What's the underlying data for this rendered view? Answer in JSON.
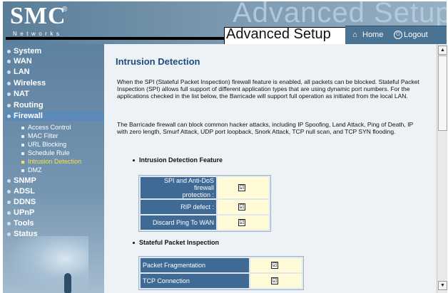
{
  "brand": {
    "logo": "SMC",
    "registered": "®",
    "sub": "Networks",
    "watermark": "Advanced Setup"
  },
  "header": {
    "title": "Advanced Setup",
    "home_icon": "⌂",
    "home_label": "Home",
    "logout_icon": "⏻",
    "logout_label": "Logout"
  },
  "sidebar": {
    "items": [
      {
        "label": "System"
      },
      {
        "label": "WAN"
      },
      {
        "label": "LAN"
      },
      {
        "label": "Wireless"
      },
      {
        "label": "NAT"
      },
      {
        "label": "Routing"
      },
      {
        "label": "Firewall"
      },
      {
        "label": "SNMP"
      },
      {
        "label": "ADSL"
      },
      {
        "label": "DDNS"
      },
      {
        "label": "UPnP"
      },
      {
        "label": "Tools"
      },
      {
        "label": "Status"
      }
    ],
    "firewall_sub": [
      {
        "label": "Access Control"
      },
      {
        "label": "MAC Filter"
      },
      {
        "label": "URL Blocking"
      },
      {
        "label": "Schedule Rule"
      },
      {
        "label": "Intrusion Detection"
      },
      {
        "label": "DMZ"
      }
    ]
  },
  "main": {
    "title": "Intrusion Detection",
    "para1": "When the SPI (Stateful Packet Inspection) firewall feature is enabled, all packets can be blocked. Stateful Packet Inspection (SPI) allows full support of different application types that are using dynamic port numbers. For the applications checked in the list below, the Barricade will support full operation as initiated from the local LAN.",
    "para2": "The Barricade firewall can block common hacker attacks, including IP Spoofing, Land Attack, Ping of Death, IP with zero length, Smurf Attack, UDP port loopback, Snork Attack, TCP null scan, and TCP SYN flooding.",
    "section1": "Intrusion Detection Feature",
    "feature_rows": [
      {
        "label1": "SPI and Anti-DoS firewall",
        "label2": "protection :",
        "checked": "☑"
      },
      {
        "label1": "RIP defect :",
        "label2": "",
        "checked": "☑"
      },
      {
        "label1": "Discard Ping To WAN",
        "label2": "",
        "checked": "☑"
      }
    ],
    "section2": "Stateful Packet Inspection",
    "spi_rows": [
      {
        "label": "Packet Fragmentation",
        "checked": "☑"
      },
      {
        "label": "TCP Connection",
        "checked": "☑"
      }
    ]
  },
  "scrollbar": {
    "up": "▲",
    "down": "▼"
  }
}
